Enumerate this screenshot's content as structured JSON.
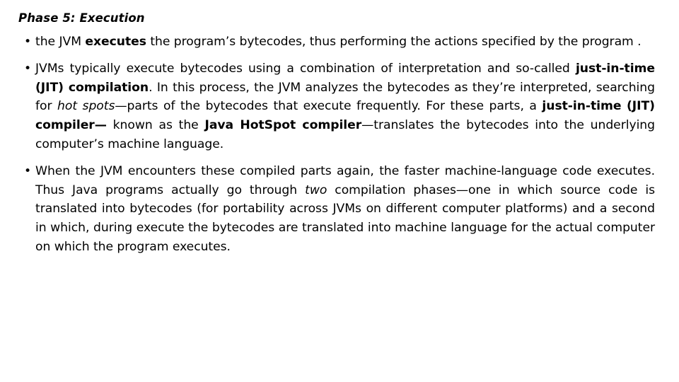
{
  "slide": {
    "title": "Phase 5: Execution",
    "bullet_marker": "•",
    "bullets": [
      {
        "id": "bullet-jvm-executes",
        "runs": [
          {
            "text": "the JVM ",
            "style": "normal"
          },
          {
            "text": "executes",
            "style": "bold"
          },
          {
            "text": " the program’s bytecodes, thus performing the actions specified by the program .",
            "style": "normal"
          }
        ],
        "plain": "the JVM executes the program’s bytecodes, thus performing the actions specified by the program ."
      },
      {
        "id": "bullet-jit-compilation",
        "runs": [
          {
            "text": "JVMs typically execute bytecodes using a combination of interpretation and so-called ",
            "style": "normal"
          },
          {
            "text": "just-in-time (JIT) compilation",
            "style": "bold"
          },
          {
            "text": ". In this process, the JVM analyzes the bytecodes as they’re interpreted, searching for ",
            "style": "normal"
          },
          {
            "text": "hot spots",
            "style": "italic"
          },
          {
            "text": "—parts of the bytecodes that execute frequently. For these parts, a ",
            "style": "normal"
          },
          {
            "text": "just-in-time",
            "style": "bold"
          },
          {
            "text": " ",
            "style": "normal"
          },
          {
            "text": "(JIT) compiler—",
            "style": "bold"
          },
          {
            "text": " known as the ",
            "style": "normal"
          },
          {
            "text": "Java HotSpot compiler",
            "style": "bold"
          },
          {
            "text": "—translates the bytecodes into the underlying computer’s machine language.",
            "style": "normal"
          }
        ],
        "plain": "JVMs typically execute bytecodes using a combination of interpretation and so-called just-in-time (JIT) compilation. In this process, the JVM analyzes the bytecodes as they’re interpreted, searching for hot spots—parts of the bytecodes that execute frequently. For these parts, a just-in-time (JIT) compiler— known as the Java HotSpot compiler—translates the bytecodes into the underlying computer’s machine language."
      },
      {
        "id": "bullet-compiled-parts",
        "runs": [
          {
            "text": "When the JVM encounters these compiled parts again, the faster machine-language code executes. Thus Java programs actually go through ",
            "style": "normal"
          },
          {
            "text": "two",
            "style": "italic"
          },
          {
            "text": " compilation phases—one in which source code is translated into bytecodes (for portability across JVMs on different computer platforms) and a second in which, during execute the bytecodes are translated into machine language for the actual computer on which the program executes.",
            "style": "normal"
          }
        ],
        "plain": "When the JVM encounters these compiled parts again, the faster machine-language code executes. Thus Java programs actually go through two compilation phases—one in which source code is translated into bytecodes (for portability across JVMs on different computer platforms) and a second in which, during execute the bytecodes are translated into machine language for the actual computer on which the program executes."
      }
    ]
  },
  "colors": {
    "background": "#ffffff",
    "text": "#000000"
  }
}
